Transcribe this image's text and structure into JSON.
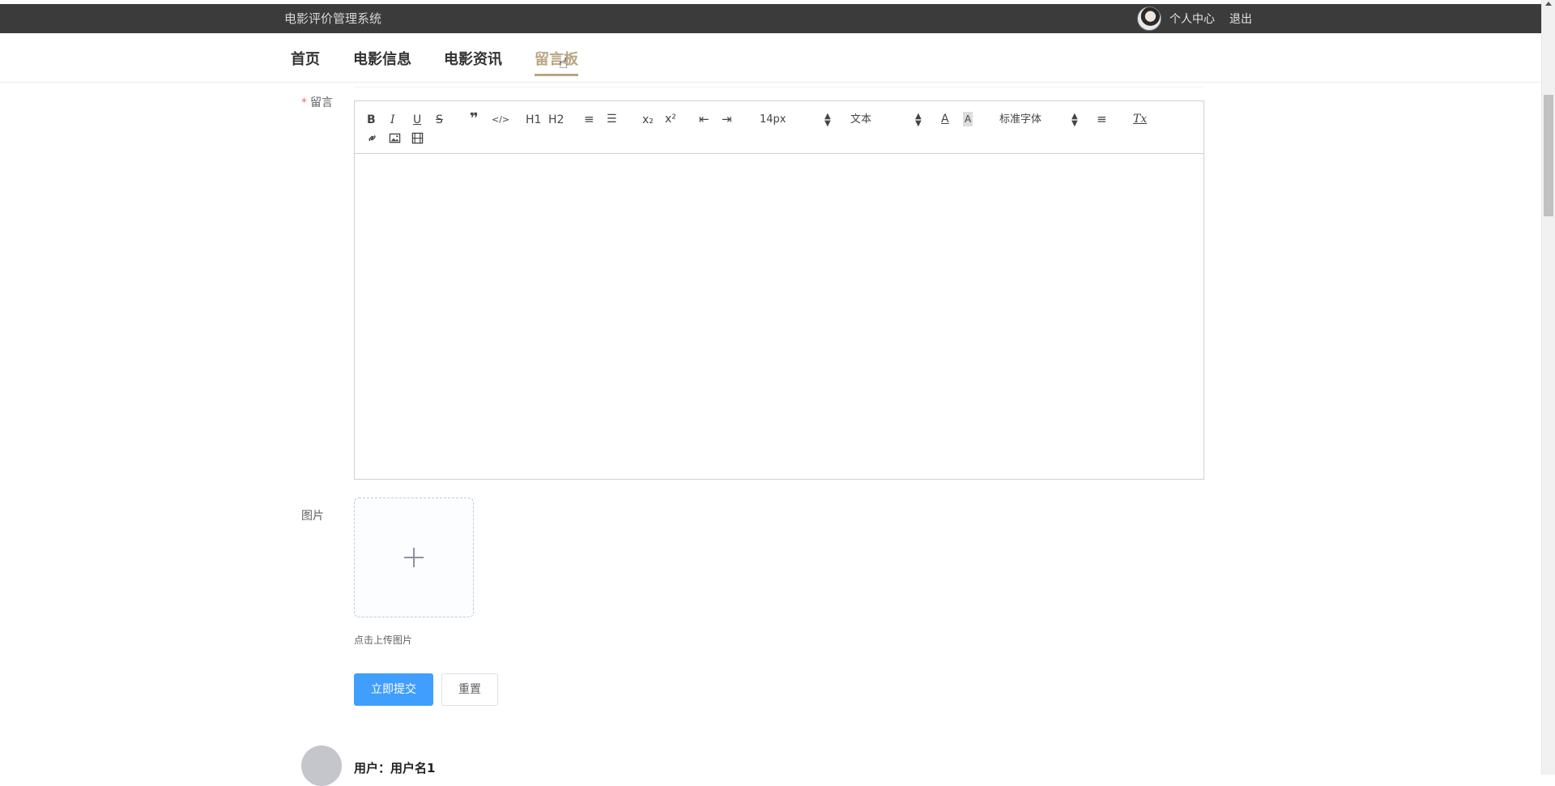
{
  "header": {
    "site_title": "电影评价管理系统",
    "links": [
      "个人中心",
      "退出"
    ]
  },
  "nav": {
    "items": [
      "首页",
      "电影信息",
      "电影资讯",
      "留言板"
    ],
    "active": "留言板"
  },
  "form": {
    "message_label": "留言",
    "required_mark": "*",
    "image_label": "图片",
    "upload_tip": "点击上传图片",
    "submit_label": "立即提交",
    "reset_label": "重置"
  },
  "editor": {
    "toolbar": {
      "bold": "B",
      "italic": "I",
      "underline": "U",
      "strike": "S",
      "blockquote": "❞",
      "code": "</>",
      "h1": "H1",
      "h2": "H2",
      "ordered_list": "≡",
      "bullet_list": "☰",
      "subscript": "x₂",
      "superscript": "x²",
      "outdent": "⇤",
      "indent": "⇥",
      "font_size": "14px",
      "header_select": "文本",
      "font_color": "A",
      "background_color": "A",
      "font_family": "标准字体",
      "align": "≡",
      "clean": "Tx"
    }
  },
  "comments": [
    {
      "user": "用户：用户名1"
    }
  ]
}
